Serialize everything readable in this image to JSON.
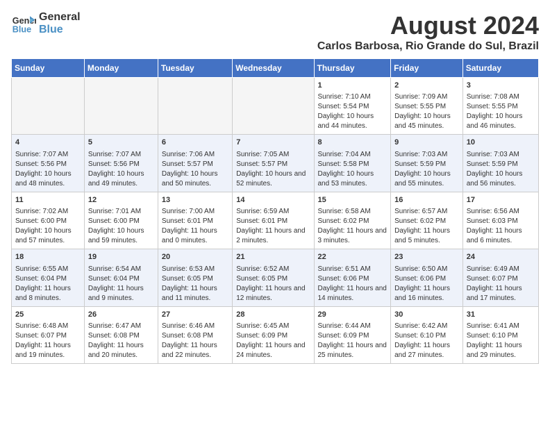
{
  "header": {
    "logo_line1": "General",
    "logo_line2": "Blue",
    "month": "August 2024",
    "location": "Carlos Barbosa, Rio Grande do Sul, Brazil"
  },
  "weekdays": [
    "Sunday",
    "Monday",
    "Tuesday",
    "Wednesday",
    "Thursday",
    "Friday",
    "Saturday"
  ],
  "weeks": [
    [
      {
        "day": "",
        "empty": true
      },
      {
        "day": "",
        "empty": true
      },
      {
        "day": "",
        "empty": true
      },
      {
        "day": "",
        "empty": true
      },
      {
        "day": "1",
        "sunrise": "7:10 AM",
        "sunset": "5:54 PM",
        "daylight": "10 hours and 44 minutes."
      },
      {
        "day": "2",
        "sunrise": "7:09 AM",
        "sunset": "5:55 PM",
        "daylight": "10 hours and 45 minutes."
      },
      {
        "day": "3",
        "sunrise": "7:08 AM",
        "sunset": "5:55 PM",
        "daylight": "10 hours and 46 minutes."
      }
    ],
    [
      {
        "day": "4",
        "sunrise": "7:07 AM",
        "sunset": "5:56 PM",
        "daylight": "10 hours and 48 minutes."
      },
      {
        "day": "5",
        "sunrise": "7:07 AM",
        "sunset": "5:56 PM",
        "daylight": "10 hours and 49 minutes."
      },
      {
        "day": "6",
        "sunrise": "7:06 AM",
        "sunset": "5:57 PM",
        "daylight": "10 hours and 50 minutes."
      },
      {
        "day": "7",
        "sunrise": "7:05 AM",
        "sunset": "5:57 PM",
        "daylight": "10 hours and 52 minutes."
      },
      {
        "day": "8",
        "sunrise": "7:04 AM",
        "sunset": "5:58 PM",
        "daylight": "10 hours and 53 minutes."
      },
      {
        "day": "9",
        "sunrise": "7:03 AM",
        "sunset": "5:59 PM",
        "daylight": "10 hours and 55 minutes."
      },
      {
        "day": "10",
        "sunrise": "7:03 AM",
        "sunset": "5:59 PM",
        "daylight": "10 hours and 56 minutes."
      }
    ],
    [
      {
        "day": "11",
        "sunrise": "7:02 AM",
        "sunset": "6:00 PM",
        "daylight": "10 hours and 57 minutes."
      },
      {
        "day": "12",
        "sunrise": "7:01 AM",
        "sunset": "6:00 PM",
        "daylight": "10 hours and 59 minutes."
      },
      {
        "day": "13",
        "sunrise": "7:00 AM",
        "sunset": "6:01 PM",
        "daylight": "11 hours and 0 minutes."
      },
      {
        "day": "14",
        "sunrise": "6:59 AM",
        "sunset": "6:01 PM",
        "daylight": "11 hours and 2 minutes."
      },
      {
        "day": "15",
        "sunrise": "6:58 AM",
        "sunset": "6:02 PM",
        "daylight": "11 hours and 3 minutes."
      },
      {
        "day": "16",
        "sunrise": "6:57 AM",
        "sunset": "6:02 PM",
        "daylight": "11 hours and 5 minutes."
      },
      {
        "day": "17",
        "sunrise": "6:56 AM",
        "sunset": "6:03 PM",
        "daylight": "11 hours and 6 minutes."
      }
    ],
    [
      {
        "day": "18",
        "sunrise": "6:55 AM",
        "sunset": "6:04 PM",
        "daylight": "11 hours and 8 minutes."
      },
      {
        "day": "19",
        "sunrise": "6:54 AM",
        "sunset": "6:04 PM",
        "daylight": "11 hours and 9 minutes."
      },
      {
        "day": "20",
        "sunrise": "6:53 AM",
        "sunset": "6:05 PM",
        "daylight": "11 hours and 11 minutes."
      },
      {
        "day": "21",
        "sunrise": "6:52 AM",
        "sunset": "6:05 PM",
        "daylight": "11 hours and 12 minutes."
      },
      {
        "day": "22",
        "sunrise": "6:51 AM",
        "sunset": "6:06 PM",
        "daylight": "11 hours and 14 minutes."
      },
      {
        "day": "23",
        "sunrise": "6:50 AM",
        "sunset": "6:06 PM",
        "daylight": "11 hours and 16 minutes."
      },
      {
        "day": "24",
        "sunrise": "6:49 AM",
        "sunset": "6:07 PM",
        "daylight": "11 hours and 17 minutes."
      }
    ],
    [
      {
        "day": "25",
        "sunrise": "6:48 AM",
        "sunset": "6:07 PM",
        "daylight": "11 hours and 19 minutes."
      },
      {
        "day": "26",
        "sunrise": "6:47 AM",
        "sunset": "6:08 PM",
        "daylight": "11 hours and 20 minutes."
      },
      {
        "day": "27",
        "sunrise": "6:46 AM",
        "sunset": "6:08 PM",
        "daylight": "11 hours and 22 minutes."
      },
      {
        "day": "28",
        "sunrise": "6:45 AM",
        "sunset": "6:09 PM",
        "daylight": "11 hours and 24 minutes."
      },
      {
        "day": "29",
        "sunrise": "6:44 AM",
        "sunset": "6:09 PM",
        "daylight": "11 hours and 25 minutes."
      },
      {
        "day": "30",
        "sunrise": "6:42 AM",
        "sunset": "6:10 PM",
        "daylight": "11 hours and 27 minutes."
      },
      {
        "day": "31",
        "sunrise": "6:41 AM",
        "sunset": "6:10 PM",
        "daylight": "11 hours and 29 minutes."
      }
    ]
  ]
}
